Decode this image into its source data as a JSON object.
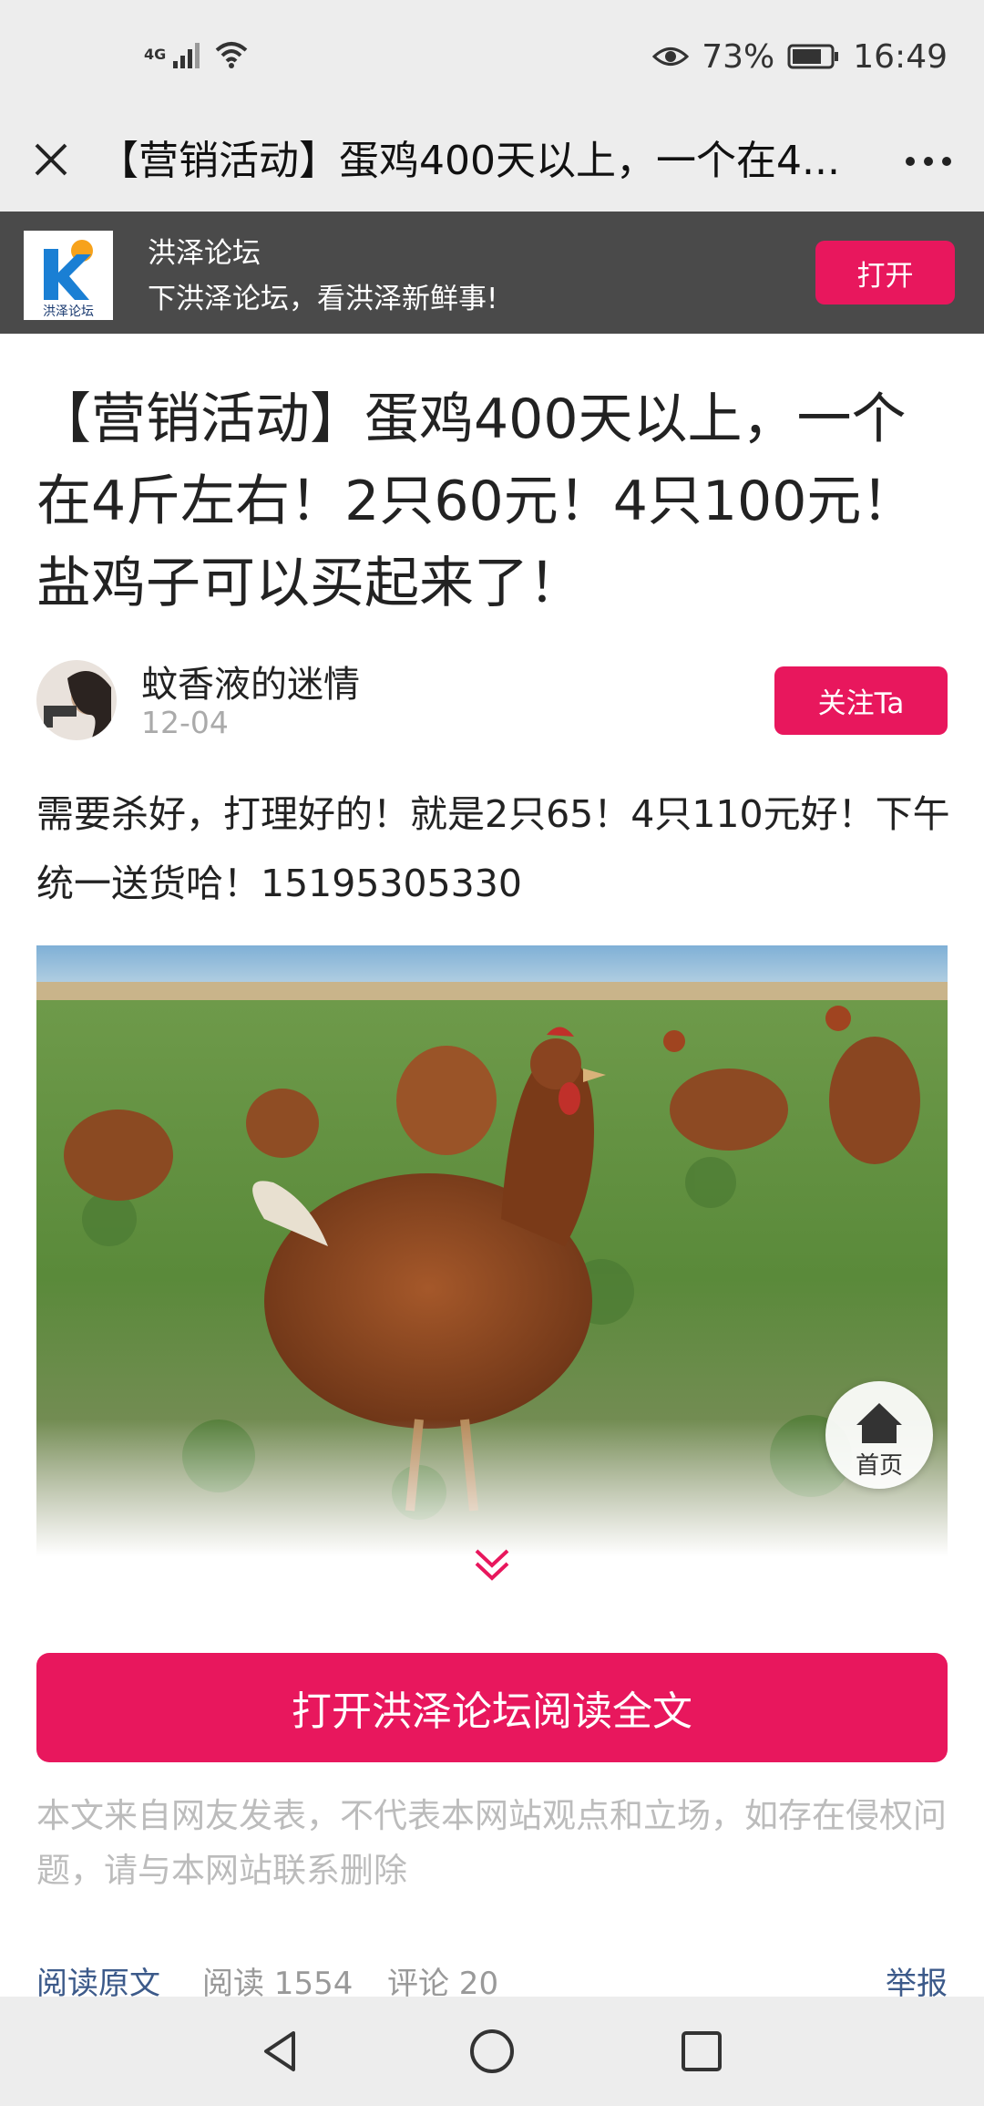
{
  "status_bar": {
    "signal_label": "4G",
    "battery_percent": "73%",
    "time": "16:49"
  },
  "title_bar": {
    "title": "【营销活动】蛋鸡400天以上，一个在4..."
  },
  "app_banner": {
    "logo_text": "洪泽论坛",
    "app_name": "洪泽论坛",
    "slogan": "下洪泽论坛，看洪泽新鲜事!",
    "open_label": "打开"
  },
  "article": {
    "title": "【营销活动】蛋鸡400天以上，一个在4斤左右！2只60元！4只100元！盐鸡子可以买起来了！",
    "author": "蚊香液的迷情",
    "date": "12-04",
    "follow_label": "关注Ta",
    "body": "需要杀好，打理好的！就是2只65！4只110元好！下午统一送货哈！15195305330"
  },
  "home_fab": {
    "label": "首页"
  },
  "read_full_label": "打开洪泽论坛阅读全文",
  "disclaimer": "本文来自网友发表，不代表本网站观点和立场，如存在侵权问题，请与本网站联系删除",
  "footer": {
    "read_original": "阅读原文",
    "read_count": "阅读 1554",
    "comment_count": "评论 20",
    "report": "举报"
  },
  "colors": {
    "accent": "#e8175d",
    "banner_bg": "#4a4a4a",
    "link": "#3c5a8a"
  }
}
